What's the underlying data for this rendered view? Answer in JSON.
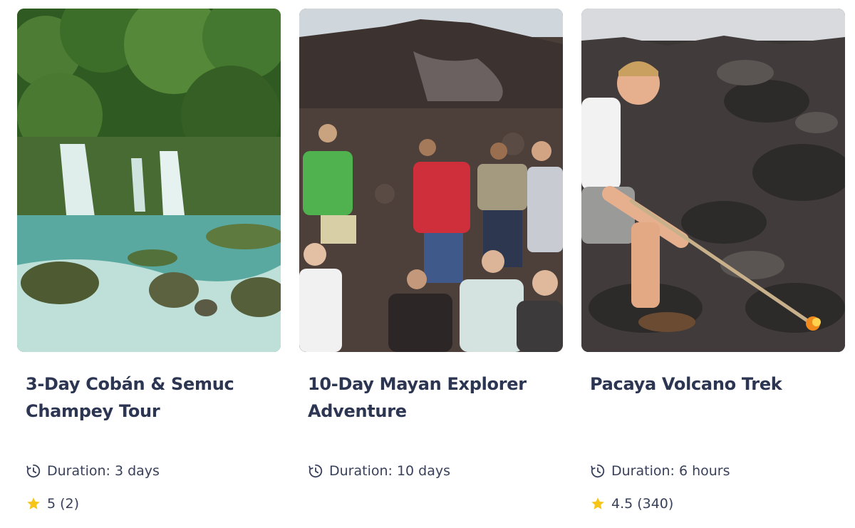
{
  "cards": [
    {
      "title": "3-Day Cobán & Semuc Champey Tour",
      "duration_label": "Duration:",
      "duration_value": "3 days",
      "rating": "5",
      "reviews": "(2)",
      "image_subject": "waterfalls-jungle"
    },
    {
      "title": "10-Day Mayan Explorer Adventure",
      "duration_label": "Duration:",
      "duration_value": "10 days",
      "rating": "",
      "reviews": "",
      "image_subject": "group-on-volcano"
    },
    {
      "title": "Pacaya Volcano Trek",
      "duration_label": "Duration:",
      "duration_value": "6 hours",
      "rating": "4.5",
      "reviews": "(340)",
      "image_subject": "hiker-lava-stick"
    }
  ],
  "icons": {
    "duration": "clock-icon",
    "rating": "star-icon"
  },
  "colors": {
    "title": "#2c3551",
    "text": "#39405a",
    "star": "#f5c518"
  }
}
